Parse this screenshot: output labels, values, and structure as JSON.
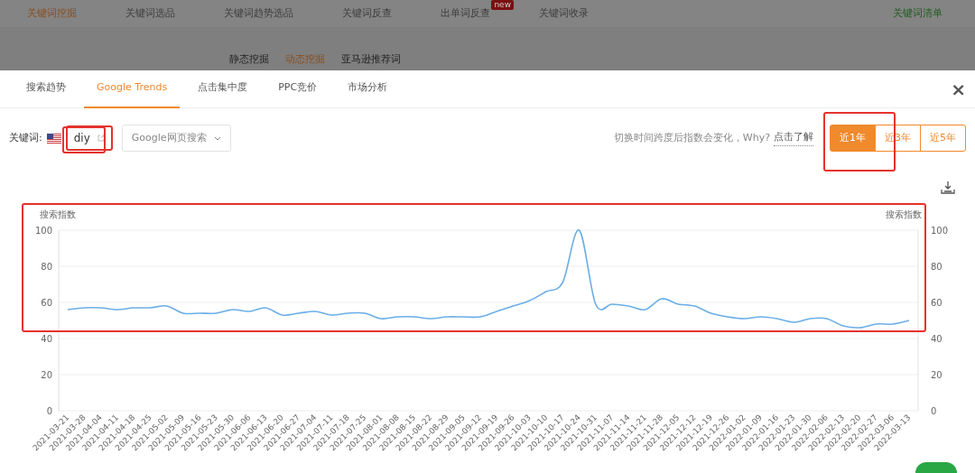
{
  "nav": {
    "tabs": [
      {
        "label": "关键词挖掘",
        "selected": true
      },
      {
        "label": "关键词选品",
        "selected": false
      },
      {
        "label": "关键词趋势选品",
        "selected": false
      },
      {
        "label": "关键词反查",
        "selected": false
      },
      {
        "label": "出单词反查",
        "selected": false,
        "badge": "new"
      },
      {
        "label": "关键词收录",
        "selected": false
      }
    ],
    "right_link": "关键词清单",
    "subtabs": [
      {
        "label": "静态挖掘",
        "selected": false
      },
      {
        "label": "动态挖掘",
        "selected": true
      },
      {
        "label": "亚马逊推荐词",
        "selected": false
      }
    ]
  },
  "modal": {
    "tabs": [
      {
        "label": "搜索趋势",
        "selected": false
      },
      {
        "label": "Google Trends",
        "selected": true
      },
      {
        "label": "点击集中度",
        "selected": false
      },
      {
        "label": "PPC竞价",
        "selected": false
      },
      {
        "label": "市场分析",
        "selected": false
      }
    ],
    "close": "×",
    "keyword_label": "关键词:",
    "keyword": "diy",
    "search_type": "Google网页搜索",
    "hint": "切换时间跨度后指数会变化，Why?",
    "hint_link": "点击了解",
    "ranges": [
      {
        "label": "近1年",
        "selected": true
      },
      {
        "label": "近3年",
        "selected": false
      },
      {
        "label": "近5年",
        "selected": false
      }
    ],
    "right_axis": {
      "title": "搜索指数",
      "ticks": [
        "100",
        "80",
        "60",
        "40",
        "20",
        "0"
      ]
    },
    "chart_data": {
      "type": "line",
      "ylabel": "搜索指数",
      "grid": true,
      "ylim": [
        0,
        100
      ],
      "yticks": [
        {
          "value": 0,
          "label": "0"
        },
        {
          "value": 20,
          "label": "20"
        },
        {
          "value": 40,
          "label": "40"
        },
        {
          "value": 60,
          "label": "60"
        },
        {
          "value": 80,
          "label": "80"
        },
        {
          "value": 100,
          "label": "100"
        }
      ],
      "categories": [
        "2021-03-21",
        "2021-03-28",
        "2021-04-04",
        "2021-04-11",
        "2021-04-18",
        "2021-04-25",
        "2021-05-02",
        "2021-05-09",
        "2021-05-16",
        "2021-05-23",
        "2021-05-30",
        "2021-06-06",
        "2021-06-13",
        "2021-06-20",
        "2021-06-27",
        "2021-07-04",
        "2021-07-11",
        "2021-07-18",
        "2021-07-25",
        "2021-08-01",
        "2021-08-08",
        "2021-08-15",
        "2021-08-22",
        "2021-08-29",
        "2021-09-05",
        "2021-09-12",
        "2021-09-19",
        "2021-09-26",
        "2021-10-03",
        "2021-10-10",
        "2021-10-17",
        "2021-10-24",
        "2021-10-31",
        "2021-11-07",
        "2021-11-14",
        "2021-11-21",
        "2021-11-28",
        "2021-12-05",
        "2021-12-12",
        "2021-12-19",
        "2021-12-26",
        "2022-01-02",
        "2022-01-09",
        "2022-01-16",
        "2022-01-23",
        "2022-01-30",
        "2022-02-06",
        "2022-02-13",
        "2022-02-20",
        "2022-02-27",
        "2022-03-06",
        "2022-03-13"
      ],
      "series": [
        {
          "color": "#6aaee8",
          "values": [
            56,
            57,
            57,
            56,
            57,
            57,
            58,
            54,
            54,
            54,
            56,
            55,
            57,
            53,
            54,
            55,
            53,
            54,
            54,
            51,
            52,
            52,
            51,
            52,
            52,
            52,
            55,
            58,
            61,
            66,
            71,
            100,
            59,
            59,
            58,
            56,
            62,
            59,
            58,
            54,
            52,
            51,
            52,
            51,
            49,
            51,
            51,
            47,
            46,
            48,
            48,
            50
          ]
        }
      ]
    }
  }
}
